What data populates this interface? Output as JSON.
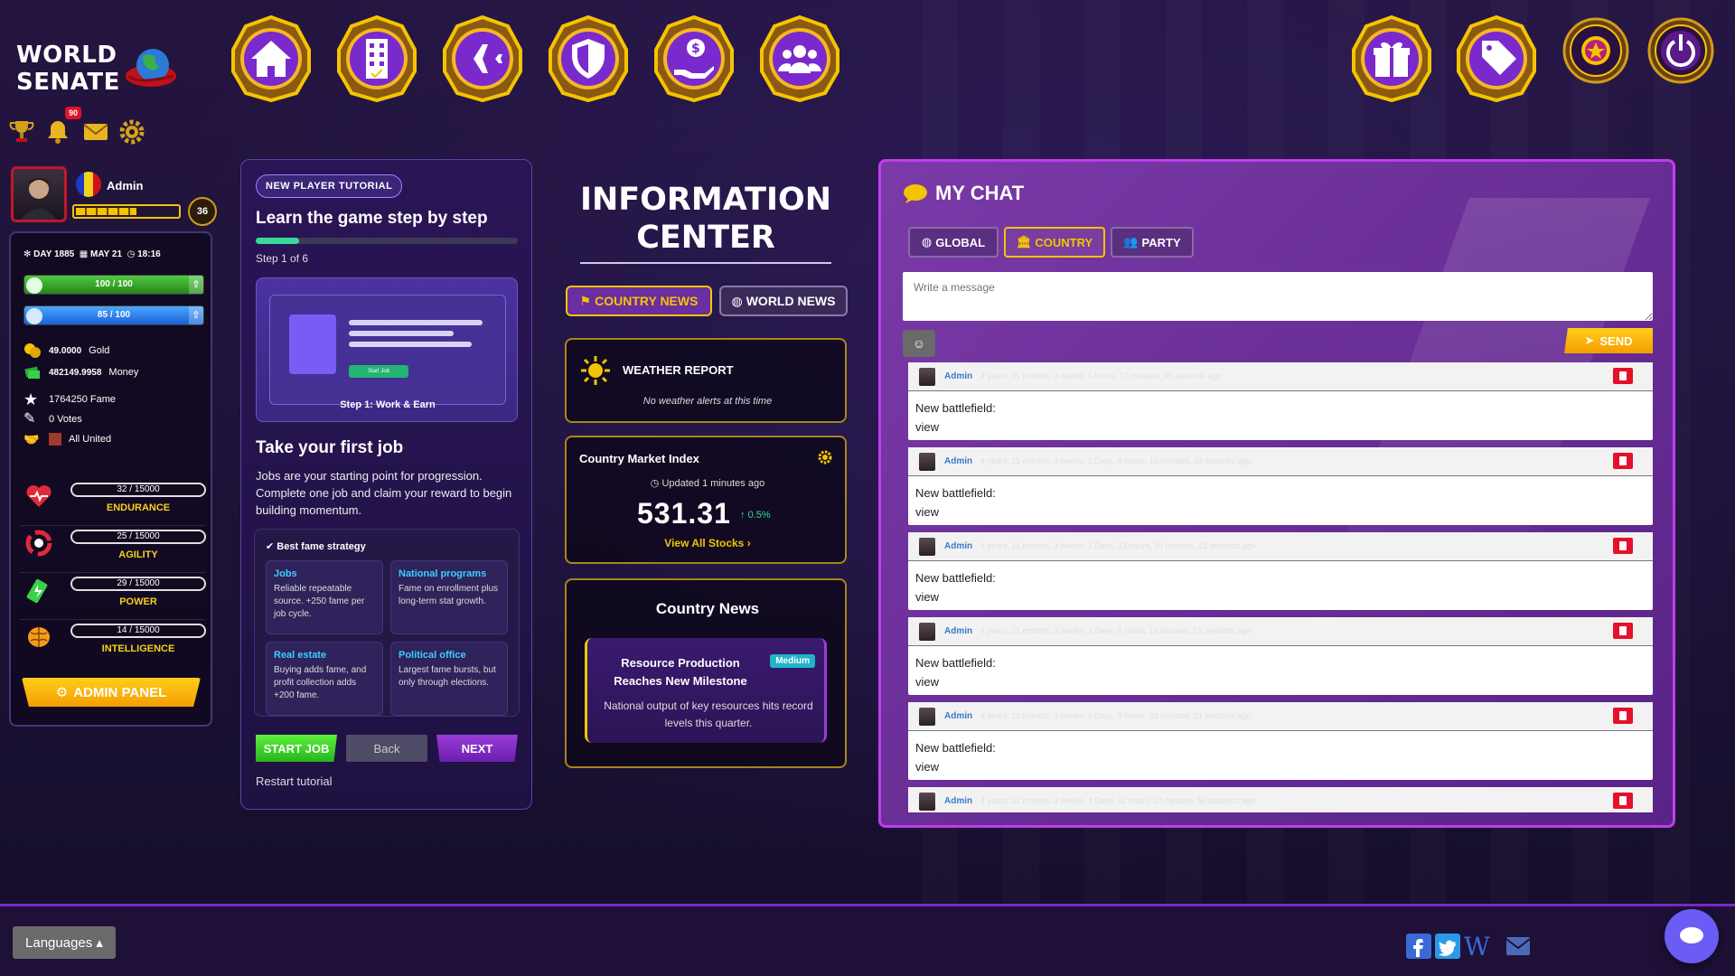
{
  "app": {
    "logo_line1": "WORLD",
    "logo_line2": "SENATE",
    "notifications_badge": "90"
  },
  "nav": [
    {
      "id": "home",
      "icon": "home-icon"
    },
    {
      "id": "buildings",
      "icon": "building-icon"
    },
    {
      "id": "military",
      "icon": "jet-icon"
    },
    {
      "id": "defense",
      "icon": "shield-icon"
    },
    {
      "id": "economy",
      "icon": "money-hand-icon"
    },
    {
      "id": "people",
      "icon": "users-icon"
    },
    {
      "id": "gifts",
      "icon": "gift-icon"
    },
    {
      "id": "shop",
      "icon": "tags-icon"
    },
    {
      "id": "premium",
      "icon": "star-icon"
    },
    {
      "id": "logout",
      "icon": "power-icon"
    }
  ],
  "profile": {
    "name": "Admin",
    "level": "36",
    "xp_progress": 0.6,
    "day": "DAY 1885",
    "date": "MAY 21",
    "time": "18:16",
    "health": "100 / 100",
    "health_fill": 1.0,
    "energy": "85 / 100",
    "energy_fill": 0.85,
    "gold_value": "49.0000",
    "gold_label": "Gold",
    "money_value": "482149.9958",
    "money_label": "Money",
    "fame": "1764250 Fame",
    "votes": "0 Votes",
    "party": "All United",
    "skills": [
      {
        "value": "32 / 15000",
        "label": "ENDURANCE"
      },
      {
        "value": "25 / 15000",
        "label": "AGILITY"
      },
      {
        "value": "29 / 15000",
        "label": "POWER"
      },
      {
        "value": "14 / 15000",
        "label": "INTELLIGENCE"
      }
    ],
    "admin_panel": "ADMIN PANEL"
  },
  "tutorial": {
    "badge": "NEW PLAYER TUTORIAL",
    "title": "Learn the game step by step",
    "progress": 0.1667,
    "step": "Step 1 of 6",
    "preview_button": "Start Job",
    "preview_caption": "Step 1: Work & Earn",
    "heading": "Take your first job",
    "body": "Jobs are your starting point for progression. Complete one job and claim your reward to begin building momentum.",
    "strategy_title": "Best fame strategy",
    "tiles": [
      {
        "title": "Jobs",
        "desc": "Reliable repeatable source. +250 fame per job cycle."
      },
      {
        "title": "National programs",
        "desc": "Fame on enrollment plus long-term stat growth."
      },
      {
        "title": "Real estate",
        "desc": "Buying adds fame, and profit collection adds +200 fame."
      },
      {
        "title": "Political office",
        "desc": "Largest fame bursts, but only through elections."
      }
    ],
    "start": "START JOB",
    "back": "Back",
    "next": "NEXT",
    "restart": "Restart tutorial"
  },
  "info": {
    "title_line1": "INFORMATION",
    "title_line2": "CENTER",
    "tab_country": "COUNTRY NEWS",
    "tab_world": "WORLD NEWS",
    "weather_title": "WEATHER REPORT",
    "weather_status": "No weather alerts at this time",
    "market_title": "Country Market Index",
    "market_updated": "Updated 1 minutes ago",
    "market_value": "531.31",
    "market_change": "0.5%",
    "market_link": "View All Stocks",
    "country_news_title": "Country News",
    "news_headline": "Resource Production Reaches New Milestone",
    "news_tag": "Medium",
    "news_desc": "National output of key resources hits record levels this quarter."
  },
  "chat": {
    "title": "MY CHAT",
    "tab_global": "GLOBAL",
    "tab_country": "COUNTRY",
    "tab_party": "PARTY",
    "placeholder": "Write a message",
    "send": "SEND",
    "messages": [
      {
        "author": "Admin",
        "time": "4 years, 11 months, 3 weeks, 6 hours, 17 minutes, 46 seconds ago",
        "line1": "New battlefield:",
        "line2": "view"
      },
      {
        "author": "Admin",
        "time": "4 years, 11 months, 3 weeks, 1 Days, 6 hours, 16 minutes, 24 seconds ago",
        "line1": "New battlefield:",
        "line2": "view"
      },
      {
        "author": "Admin",
        "time": "4 years, 11 months, 3 weeks, 1 Days, 13 hours, 10 minutes, 21 seconds ago",
        "line1": "New battlefield:",
        "line2": "view"
      },
      {
        "author": "Admin",
        "time": "4 years, 11 months, 3 weeks, 2 Days, 5 hours, 11 minutes, 13 seconds ago",
        "line1": "New battlefield:",
        "line2": "view"
      },
      {
        "author": "Admin",
        "time": "4 years, 11 months, 3 weeks, 3 Days, 8 hours, 32 minutes, 21 seconds ago",
        "line1": "New battlefield:",
        "line2": "view"
      },
      {
        "author": "Admin",
        "time": "4 years, 11 months, 3 weeks, 4 Days, 11 hours, 17 minutes, 56 seconds ago",
        "line1": "",
        "line2": ""
      }
    ]
  },
  "footer": {
    "languages": "Languages ▴"
  },
  "colors": {
    "accent": "#f5c400",
    "purple": "#7a2acc",
    "chat_border": "#c23cf0"
  }
}
